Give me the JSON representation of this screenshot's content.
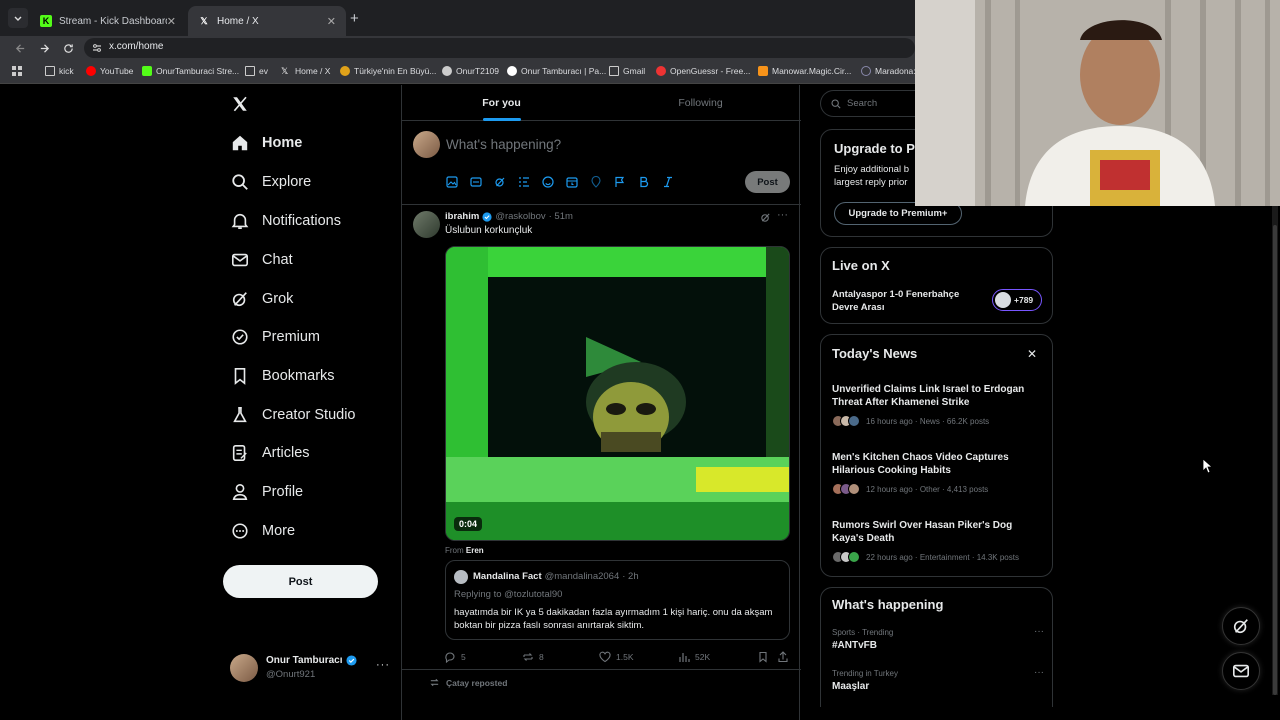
{
  "browser": {
    "tabs": [
      {
        "title": "Stream - Kick Dashboard",
        "favicon": "kick-icon",
        "color": "#53fc18"
      },
      {
        "title": "Home / X",
        "favicon": "x-logo-icon",
        "color": "#ffffff"
      }
    ],
    "url": "x.com/home",
    "bookmarks": [
      {
        "label": "kick",
        "icon": "folder-icon"
      },
      {
        "label": "YouTube",
        "icon": "youtube-icon"
      },
      {
        "label": "OnurTamburaci Stre...",
        "icon": "kick-icon"
      },
      {
        "label": "ev",
        "icon": "folder-icon"
      },
      {
        "label": "Home / X",
        "icon": "x-logo-icon"
      },
      {
        "label": "Türkiye'nin En Büyü...",
        "icon": "site-icon"
      },
      {
        "label": "OnurT2109",
        "icon": "steam-icon"
      },
      {
        "label": "Onur Tamburacı | Pa...",
        "icon": "patreon-icon"
      },
      {
        "label": "Gmail",
        "icon": "folder-icon"
      },
      {
        "label": "OpenGuessr - Free...",
        "icon": "site-icon"
      },
      {
        "label": "Manowar.Magic.Cir...",
        "icon": "bitcoin-icon"
      },
      {
        "label": "Maradona:",
        "icon": "site-icon"
      }
    ]
  },
  "sidebar": {
    "items": [
      {
        "label": "Home",
        "icon": "home-icon"
      },
      {
        "label": "Explore",
        "icon": "search-icon"
      },
      {
        "label": "Notifications",
        "icon": "bell-icon"
      },
      {
        "label": "Chat",
        "icon": "mail-icon"
      },
      {
        "label": "Grok",
        "icon": "grok-icon"
      },
      {
        "label": "Premium",
        "icon": "verified-icon"
      },
      {
        "label": "Bookmarks",
        "icon": "bookmark-icon"
      },
      {
        "label": "Creator Studio",
        "icon": "flask-icon"
      },
      {
        "label": "Articles",
        "icon": "article-icon"
      },
      {
        "label": "Profile",
        "icon": "person-icon"
      },
      {
        "label": "More",
        "icon": "more-circle-icon"
      }
    ],
    "post_label": "Post",
    "account": {
      "name": "Onur Tamburacı",
      "handle": "@Onurt921"
    }
  },
  "feed": {
    "tabs": [
      "For you",
      "Following"
    ],
    "compose": {
      "placeholder": "What's happening?",
      "post_label": "Post"
    },
    "tweet": {
      "name": "ibrahim",
      "handle": "@raskolbov",
      "time": "· 51m",
      "text": "Üslubun korkunçluk",
      "video_time": "0:04",
      "from_label": "From",
      "from_user": "Eren",
      "quote": {
        "name": "Mandalina Fact",
        "handle": "@mandalina2064",
        "time": "· 2h",
        "replying": "Replying to @tozlutotal90",
        "text": "hayatımda bir IK ya 5 dakikadan fazla ayırmadım 1 kişi hariç. onu da akşam boktan bir pizza faslı sonrası anırtarak siktim."
      },
      "stats": {
        "replies": "5",
        "reposts": "8",
        "likes": "1.5K",
        "views": "52K"
      }
    },
    "next_repost": "Çatay reposted"
  },
  "right": {
    "search_placeholder": "Search",
    "premium": {
      "title": "Upgrade to P",
      "text1": "Enjoy additional b",
      "text2": "largest reply prior",
      "button": "Upgrade to Premium+"
    },
    "live": {
      "title": "Live on X",
      "event1": "Antalyaspor 1-0 Fenerbahçe",
      "event2": "Devre Arası",
      "count": "+789"
    },
    "news": {
      "title": "Today's News",
      "items": [
        {
          "title1": "Unverified Claims Link Israel to Erdogan",
          "title2": "Threat After Khamenei Strike",
          "meta": "16 hours ago · News · 66.2K posts"
        },
        {
          "title1": "Men's Kitchen Chaos Video Captures",
          "title2": "Hilarious Cooking Habits",
          "meta": "12 hours ago · Other · 4,413 posts"
        },
        {
          "title1": "Rumors Swirl Over Hasan Piker's Dog",
          "title2": "Kaya's Death",
          "meta": "22 hours ago · Entertainment · 14.3K posts"
        }
      ]
    },
    "happening": {
      "title": "What's happening",
      "items": [
        {
          "context": "Sports · Trending",
          "topic": "#ANTvFB"
        },
        {
          "context": "Trending in Turkey",
          "topic": "Maaşlar"
        }
      ]
    }
  }
}
